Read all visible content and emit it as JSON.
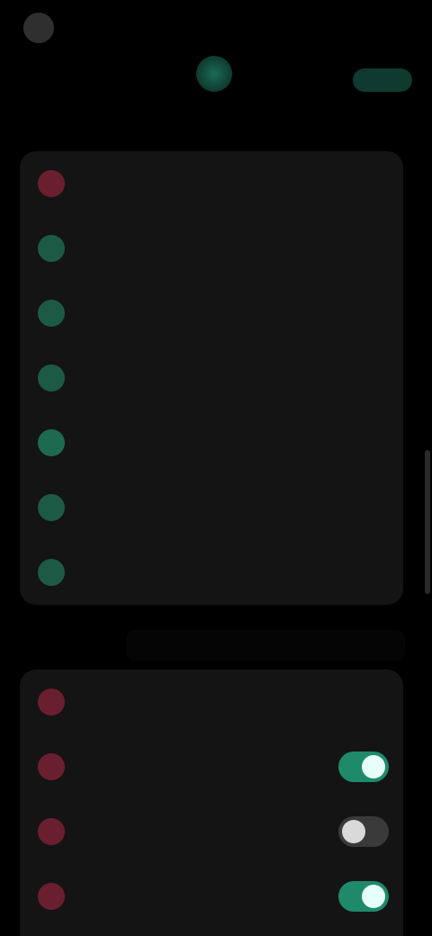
{
  "status": {
    "time": "",
    "right": ""
  },
  "section1": {
    "title": "",
    "items": [
      {
        "label": "",
        "icon": "alert-icon",
        "color": "#6a1f2f"
      },
      {
        "label": "",
        "icon": "shield-icon",
        "color": "#1d5a45"
      },
      {
        "label": "",
        "icon": "person-icon",
        "color": "#1d5a45"
      },
      {
        "label": "",
        "icon": "lock-icon",
        "color": "#1d5a45"
      },
      {
        "label": "",
        "icon": "key-icon",
        "color": "#1d6a50"
      },
      {
        "label": "",
        "icon": "device-icon",
        "color": "#1d5a45"
      },
      {
        "label": "",
        "icon": "eye-icon",
        "color": "#1d5a45"
      }
    ]
  },
  "section2": {
    "title": "",
    "items": [
      {
        "label": "",
        "icon": "alert-icon",
        "color": "#6a1f2f"
      },
      {
        "label": "",
        "icon": "alert-icon",
        "color": "#6a1f2f",
        "toggle": true,
        "state": "on"
      },
      {
        "label": "",
        "icon": "alert-icon",
        "color": "#6a1f2f",
        "toggle": true,
        "state": "off"
      },
      {
        "label": "",
        "icon": "alert-icon",
        "color": "#6a1f2f",
        "toggle": true,
        "state": "on"
      }
    ]
  },
  "colors": {
    "accent": "#1f8a6a",
    "danger": "#6a1f2f",
    "card": "#141414"
  }
}
